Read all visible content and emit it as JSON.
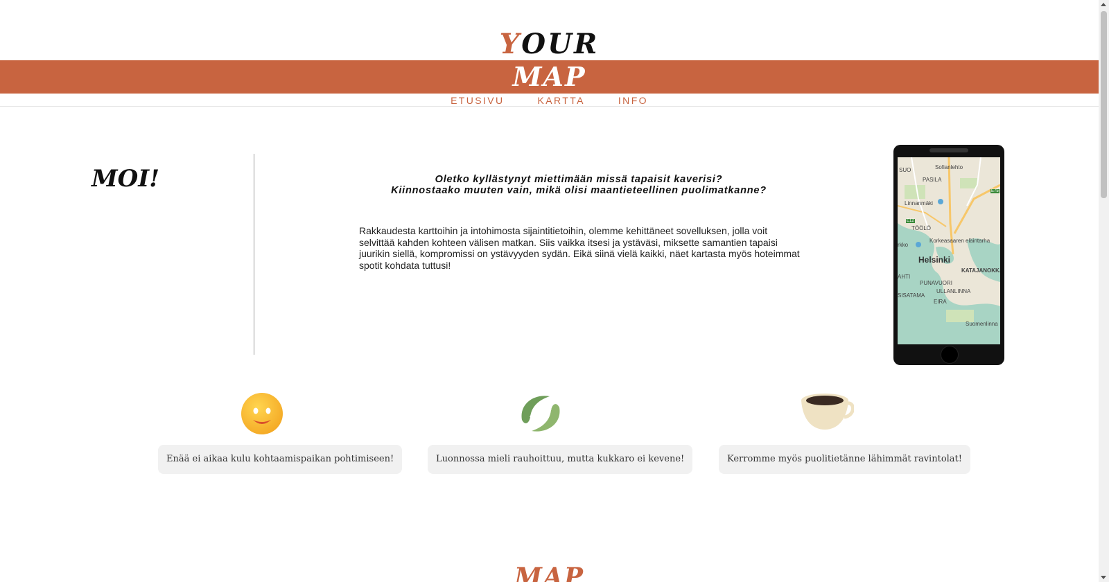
{
  "header": {
    "logo_top_accent": "Y",
    "logo_top_rest": "OUR",
    "logo_bottom": "MAP",
    "brand_color": "#c86440"
  },
  "nav": {
    "items": [
      {
        "label": "ETUSIVU"
      },
      {
        "label": "KARTTA"
      },
      {
        "label": "INFO"
      }
    ]
  },
  "intro": {
    "greeting": "MOI!",
    "question_line1": "Oletko kyllästynyt miettimään missä tapaisit kaverisi?",
    "question_line2": "Kiinnostaako muuten vain, mikä olisi maantieteellinen puolimatkanne?",
    "body": "Rakkaudesta karttoihin ja intohimosta sijaintitietoihin, olemme kehittäneet sovelluksen, jolla voit selvittää kahden kohteen välisen matkan. Siis vaikka itsesi ja ystäväsi, miksette samantien tapaisi juurikin siellä, kompromissi on ystävyyden sydän. Eikä siinä vielä kaikki, näet kartasta myös hoteimmat spotit kohdata tuttusi!"
  },
  "phone_map": {
    "labels": [
      "SUO",
      "Sofianlehto",
      "PASILA",
      "E75",
      "Linnanmäki",
      "E12",
      "TÖÖLÖ",
      "Korkeasaaren eläintarha",
      "rkko",
      "Helsinki",
      "KATAJANOKKA",
      "AHTI",
      "PUNAVUORI",
      "ULLANLINNA",
      "SISATAMA",
      "EIRA",
      "Suomenlinna"
    ]
  },
  "features": [
    {
      "icon": "smiley-face-icon",
      "text": "Enää ei aikaa kulu kohtaamispaikan pohtimiseen!"
    },
    {
      "icon": "leaf-icon",
      "text": "Luonnossa mieli rauhoittuu, mutta kukkaro ei kevene!"
    },
    {
      "icon": "coffee-cup-icon",
      "text": "Kerromme myös puolitietänne lähimmät ravintolat!"
    }
  ],
  "footer": {
    "logo": "MAP"
  }
}
